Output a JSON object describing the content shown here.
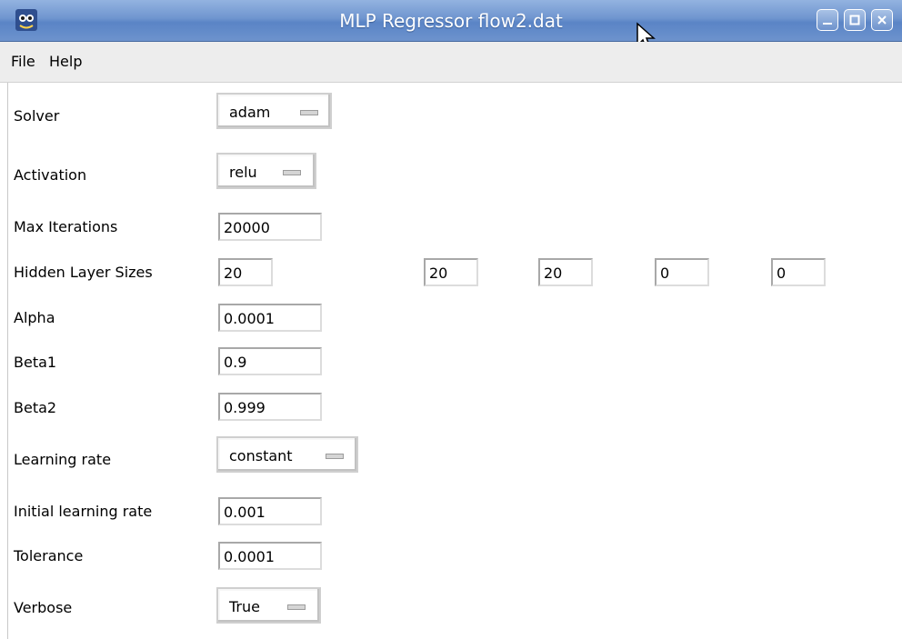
{
  "window": {
    "title": "MLP Regressor flow2.dat"
  },
  "menu": {
    "file": "File",
    "help": "Help"
  },
  "form": {
    "solver": {
      "label": "Solver",
      "value": "adam"
    },
    "activation": {
      "label": "Activation",
      "value": "relu"
    },
    "max_iterations": {
      "label": "Max Iterations",
      "value": "20000"
    },
    "hidden_layer_sizes": {
      "label": "Hidden Layer Sizes",
      "values": [
        "20",
        "20",
        "20",
        "0",
        "0"
      ]
    },
    "alpha": {
      "label": "Alpha",
      "value": "0.0001"
    },
    "beta1": {
      "label": "Beta1",
      "value": "0.9"
    },
    "beta2": {
      "label": "Beta2",
      "value": "0.999"
    },
    "learning_rate": {
      "label": "Learning rate",
      "value": "constant"
    },
    "initial_learning_rate": {
      "label": "Initial learning rate",
      "value": "0.001"
    },
    "tolerance": {
      "label": "Tolerance",
      "value": "0.0001"
    },
    "verbose": {
      "label": "Verbose",
      "value": "True"
    }
  }
}
